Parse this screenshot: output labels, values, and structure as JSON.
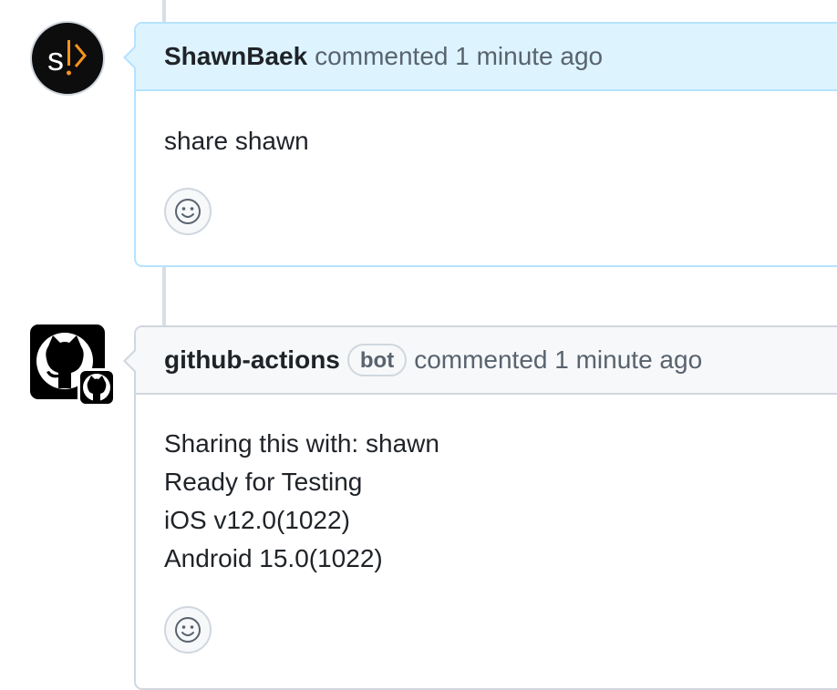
{
  "comments": [
    {
      "author": "ShawnBaek",
      "action": "commented 1 minute ago",
      "body_lines": [
        "share shawn"
      ],
      "avatar_icon": "shawn-logo-icon",
      "accent": "#f7931e"
    },
    {
      "author": "github-actions",
      "badge": "bot",
      "action": "commented 1 minute ago",
      "body_lines": [
        "Sharing this with: shawn",
        "Ready for Testing",
        "iOS v12.0(1022)",
        "Android 15.0(1022)"
      ],
      "avatar_icon": "github-octocat-icon"
    }
  ],
  "colors": {
    "header_highlight_bg": "#ddf4ff",
    "header_highlight_border": "#b6e3ff",
    "header_default_bg": "#f6f8fa",
    "border_default": "#d0d7de",
    "muted_text": "#59636e"
  },
  "reaction_icon": "smiley-icon"
}
